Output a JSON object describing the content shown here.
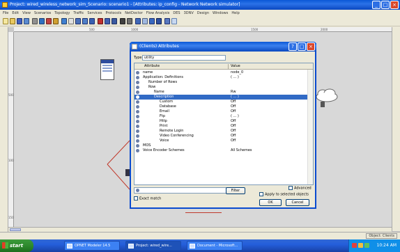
{
  "main_window": {
    "title": "Project: wired_wireless_network_sim_Scenario: scenario1 - [Attributes: ip_config - Network Network simulator]"
  },
  "menu": [
    "File",
    "Edit",
    "View",
    "Scenarios",
    "Topology",
    "Traffic",
    "Services",
    "Protocols",
    "NetDoctor",
    "Flow Analysis",
    "DES",
    "3DNV",
    "Design",
    "Windows",
    "Help"
  ],
  "ruler": {
    "top_ticks": [
      "500",
      "1000",
      "1500",
      "2000"
    ],
    "left_ticks": [
      "500",
      "1000",
      "1500"
    ]
  },
  "dialog": {
    "title": "(Clients) Attributes",
    "type_label": "Type:",
    "type_value": "utility",
    "col_attribute": "Attribute",
    "col_value": "Value",
    "rows": [
      {
        "name": "name",
        "value": "node_0",
        "indent": 0
      },
      {
        "name": "Application: Definitions",
        "value": "( ... )",
        "indent": 0
      },
      {
        "name": "Number of Rows",
        "value": "",
        "indent": 1
      },
      {
        "name": "Row",
        "value": "",
        "indent": 1
      },
      {
        "name": "Name",
        "value": "Rw",
        "indent": 2
      },
      {
        "name": "Description",
        "value": "( ... )",
        "indent": 2
      },
      {
        "name": "Custom",
        "value": "Off",
        "indent": 3
      },
      {
        "name": "Database",
        "value": "Off",
        "indent": 3
      },
      {
        "name": "Email",
        "value": "Off",
        "indent": 3
      },
      {
        "name": "Ftp",
        "value": "( ... )",
        "indent": 3
      },
      {
        "name": "Http",
        "value": "Off",
        "indent": 3
      },
      {
        "name": "Print",
        "value": "Off",
        "indent": 3
      },
      {
        "name": "Remote Login",
        "value": "Off",
        "indent": 3
      },
      {
        "name": "Video Conferencing",
        "value": "Off",
        "indent": 3
      },
      {
        "name": "Voice",
        "value": "Off",
        "indent": 3
      },
      {
        "name": "MOS",
        "value": "",
        "indent": 0
      },
      {
        "name": "Voice Encoder Schemes",
        "value": "All Schemes",
        "indent": 0
      }
    ],
    "selected_row_index": 5,
    "filter_label": "Filter",
    "apply_label": "Apply to selected objects",
    "advanced_label": "Advanced",
    "exact_match_label": "Exact match",
    "ok_label": "OK",
    "cancel_label": "Cancel"
  },
  "statusbar": {
    "right_text": "Object: Clients"
  },
  "taskbar": {
    "start_label": "start",
    "tasks": [
      {
        "label": "OPNET Modeler 14.5"
      },
      {
        "label": "Project: wired_wire..."
      },
      {
        "label": "Document - Microsoft..."
      }
    ],
    "clock": "10:24 AM"
  },
  "colors": {
    "title_blue": "#0a58d6",
    "selection_blue": "#316ac5",
    "taskbar_blue": "#245edb",
    "start_green": "#2d8a2d",
    "link_red": "#c0392b"
  }
}
